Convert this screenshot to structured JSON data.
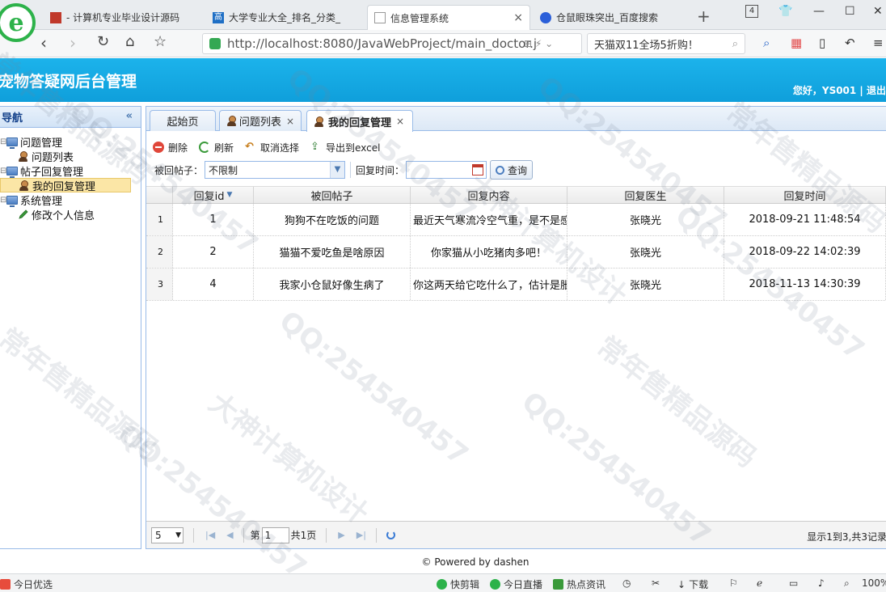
{
  "browser": {
    "tabs": [
      {
        "label": "- 计算机专业毕业设计源码",
        "active": false
      },
      {
        "label": "大学专业大全_排名_分类_",
        "favicon_text": "高",
        "active": false
      },
      {
        "label": "信息管理系统",
        "active": true
      },
      {
        "label": "仓鼠眼珠突出_百度搜索",
        "active": false
      }
    ],
    "tab_count": "4",
    "url": "http://localhost:8080/JavaWebProject/main_doctor.j",
    "search_text": "天猫双11全场5折购！",
    "colors": {
      "logo_green": "#2db24a",
      "header_blue": "#12a8e4"
    }
  },
  "app": {
    "title": "宠物答疑网后台管理",
    "greeting": "您好，YS001 | 退出"
  },
  "nav": {
    "title": "导航",
    "collapse_icon": "double-chevron-left-icon",
    "items": [
      {
        "label": "问题管理",
        "level": 0
      },
      {
        "label": "问题列表",
        "level": 1
      },
      {
        "label": "帖子回复管理",
        "level": 0
      },
      {
        "label": "我的回复管理",
        "level": 1,
        "selected": true
      },
      {
        "label": "系统管理",
        "level": 0
      },
      {
        "label": "修改个人信息",
        "level": 1
      }
    ]
  },
  "main": {
    "tabs": [
      {
        "label": "起始页"
      },
      {
        "label": "问题列表"
      },
      {
        "label": "我的回复管理",
        "active": true
      }
    ],
    "toolbar": {
      "delete": "删除",
      "refresh": "刷新",
      "unselect": "取消选择",
      "export": "导出到excel"
    },
    "search": {
      "post_label": "被回帖子：",
      "post_value": "不限制",
      "time_label": "回复时间：",
      "time_value": "",
      "query_button": "查询"
    },
    "grid": {
      "columns": [
        "回复id",
        "被回帖子",
        "回复内容",
        "回复医生",
        "回复时间"
      ],
      "rows": [
        {
          "rn": "1",
          "id": "1",
          "post": "狗狗不在吃饭的问题",
          "content": "最近天气寒流冷空气重，是不是感",
          "doctor": "张晓光",
          "time": "2018-09-21 11:48:54"
        },
        {
          "rn": "2",
          "id": "2",
          "post": "猫猫不爱吃鱼是啥原因",
          "content": "你家猫从小吃猪肉多吧！",
          "doctor": "张晓光",
          "time": "2018-09-22 14:02:39"
        },
        {
          "rn": "3",
          "id": "4",
          "post": "我家小仓鼠好像生病了",
          "content": "你这两天给它吃什么了，估计是胀",
          "doctor": "张晓光",
          "time": "2018-11-13 14:30:39"
        }
      ]
    },
    "pager": {
      "page_size": "5",
      "page_label_pre": "第",
      "page_value": "1",
      "page_label_post": "共1页",
      "info": "显示1到3,共3记录"
    }
  },
  "footer": "© Powered by dashen",
  "statusbar": {
    "left": "今日优选",
    "items": [
      "快剪辑",
      "今日直播",
      "热点资讯",
      "下载"
    ],
    "zoom": "100%"
  },
  "watermarks": [
    "QQ:254540457",
    "大神计算机设计",
    "常年售精品源码"
  ]
}
